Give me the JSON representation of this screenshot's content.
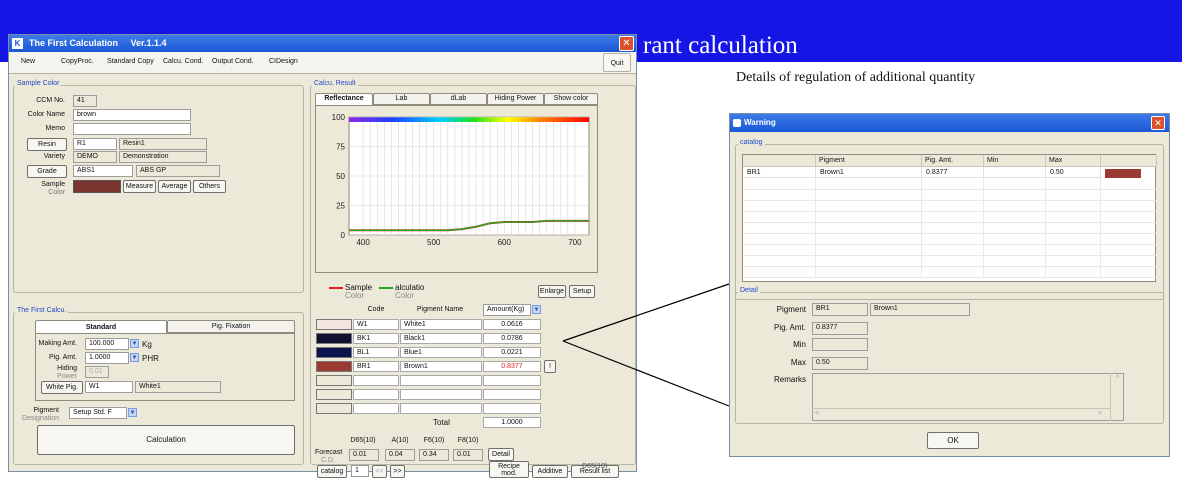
{
  "slide": {
    "banner_title": "rant calculation",
    "detail_note": "Details of regulation of additional quantity"
  },
  "app": {
    "title": "The First Calculation",
    "version": "Ver.1.1.4",
    "menu": [
      "New",
      "CopyProc.",
      "Standard Copy",
      "Calcu. Cond.",
      "Output Cond.",
      "CIDesign"
    ],
    "quit": "Quit",
    "status_right": "D65(10)"
  },
  "sample_color": {
    "group_label": "Sample Color",
    "ccm_label": "CCM No.",
    "ccm_value": "41",
    "color_name_label": "Color Name",
    "color_name_value": "brown",
    "memo_label": "Memo",
    "memo_value": "",
    "resin_button": "Resin",
    "resin_code": "R1",
    "resin_name": "Resin1",
    "variety_label": "Variety",
    "variety_code": "DEMO",
    "variety_name": "Demonstration",
    "grade_button": "Grade",
    "grade_code": "ABS1",
    "grade_name": "ABS GP",
    "sample_label": "Sample",
    "sample_sublabel": "Color",
    "sample_color": "#7a3530",
    "measure_button": "Measure",
    "average_button": "Average",
    "others_button": "Others"
  },
  "first_calcu": {
    "group_label": "The First Calcu.",
    "tab_standard": "Standard",
    "tab_fixation": "Pig. Fixation",
    "making_label": "Making Amt.",
    "making_value": "100.000",
    "making_unit": "Kg",
    "pig_amt_label": "Pig. Amt.",
    "pig_amt_value": "1.0000",
    "pig_amt_unit": "PHR",
    "hiding_label": "Hiding",
    "hiding_sublabel": "Power",
    "hiding_value": "0.01",
    "white_pig_button": "White Pig.",
    "white_code": "W1",
    "white_name": "White1",
    "pigment_label": "Pigment",
    "pigment_sublabel": "Designation",
    "pigment_value": "Setup Std. F",
    "calc_button": "Calculation"
  },
  "calcu_result": {
    "group_label": "Calcu. Result",
    "tabs": [
      "Reflectance",
      "Lab",
      "dLab",
      "Hiding Power",
      "Show color"
    ],
    "legend_sample": "Sample",
    "legend_sample_sub": "Color",
    "legend_calc": "alculatio",
    "legend_calc_sub": "Color",
    "sample_line_color": "#e02020",
    "calc_line_color": "#22aa22",
    "enlarge_button": "Enlarge",
    "setup_button": "Setup",
    "col_code": "Code",
    "col_name": "Pigment Name",
    "col_amount": "Amount(Kg)",
    "rows": [
      {
        "color": "#f3e6e0",
        "code": "W1",
        "name": "White1",
        "amount": "0.0616",
        "warn": false
      },
      {
        "color": "#101030",
        "code": "BK1",
        "name": "Black1",
        "amount": "0.0786",
        "warn": false
      },
      {
        "color": "#0c1450",
        "code": "BL1",
        "name": "Blue1",
        "amount": "0.0221",
        "warn": false
      },
      {
        "color": "#9a3a30",
        "code": "BR1",
        "name": "Brown1",
        "amount": "0.8377",
        "warn": true
      }
    ],
    "warning_color": "#e02020",
    "total_label": "Total",
    "total_value": "1.0000",
    "warn_button": "!",
    "forecast_headers": [
      "D65(10)",
      "A(10)",
      "F6(10)",
      "F8(10)"
    ],
    "forecast_label": "Forecast",
    "forecast_sublabel": "C.D.",
    "forecast_values": [
      "0.01",
      "0.04",
      "0.34",
      "0.01"
    ],
    "detail_button": "Detail",
    "catalog_button": "catalog",
    "page_value": "1",
    "prev_button": "<<",
    "next_button": ">>",
    "recipe_button": "Recipe",
    "recipe_sub": "mod.",
    "additive_button": "Additive",
    "result_list_button": "Result list"
  },
  "chart_data": {
    "type": "line",
    "title": "",
    "xlabel": "",
    "ylabel": "",
    "xlim": [
      380,
      720
    ],
    "ylim": [
      0,
      100
    ],
    "xticks": [
      "400",
      "500",
      "600",
      "700"
    ],
    "yticks": [
      "0",
      "25",
      "50",
      "75",
      "100"
    ],
    "grid": true,
    "legend": "bottom",
    "series": [
      {
        "name": "Sample Color",
        "color": "#e02020",
        "x": [
          380,
          400,
          450,
          500,
          520,
          540,
          560,
          580,
          600,
          620,
          640,
          660,
          680,
          700,
          720
        ],
        "y": [
          4,
          4,
          4,
          4,
          4,
          5,
          7,
          10,
          11,
          11,
          11,
          12,
          12,
          12,
          12
        ]
      },
      {
        "name": "Calculation Color",
        "color": "#22aa22",
        "x": [
          380,
          400,
          450,
          500,
          520,
          540,
          560,
          580,
          600,
          620,
          640,
          660,
          680,
          700,
          720
        ],
        "y": [
          4,
          4,
          4,
          4,
          4,
          5,
          7,
          10,
          11,
          11,
          11,
          12,
          12,
          12,
          12
        ]
      }
    ]
  },
  "dialog": {
    "title": "Warning",
    "catalog_label": "catalog",
    "columns": [
      "",
      "Pigment",
      "Pig. Amt.",
      "Min",
      "Max",
      ""
    ],
    "row": {
      "code": "BR1",
      "pigment": "Brown1",
      "amount": "0.8377",
      "min": "",
      "max": "0.50",
      "color": "#9a3a30"
    },
    "detail_label": "Detail",
    "pigment_label": "Pigment",
    "pigment_code": "BR1",
    "pigment_name": "Brown1",
    "pig_amt_label": "Pig. Amt.",
    "pig_amt_value": "0.8377",
    "min_label": "Min",
    "min_value": "",
    "max_label": "Max",
    "max_value": "0.50",
    "remarks_label": "Remarks",
    "remarks_value": "",
    "ok_button": "OK"
  }
}
